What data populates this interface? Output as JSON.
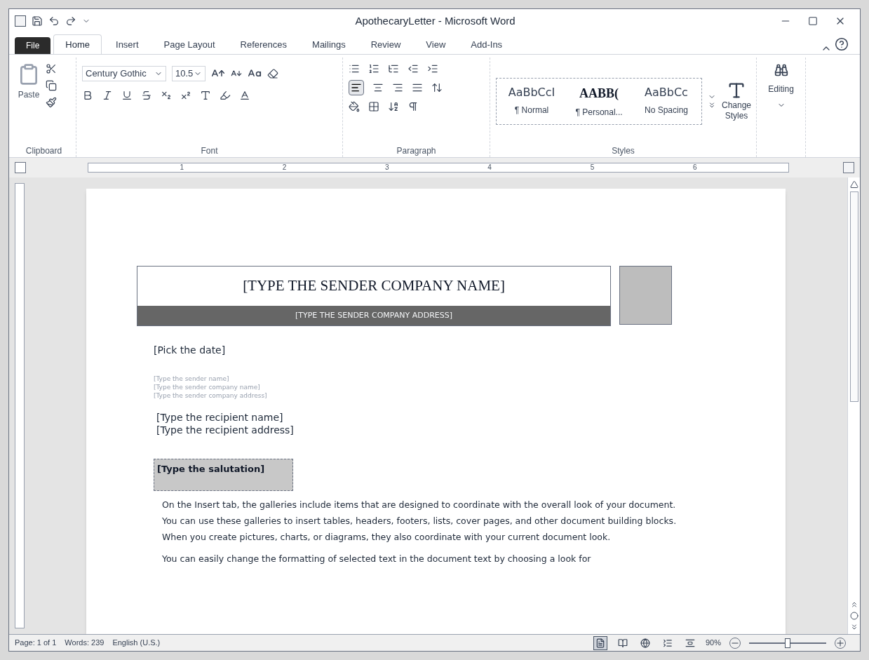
{
  "window": {
    "title": "ApothecaryLetter - Microsoft Word"
  },
  "tabs": [
    {
      "label": "File",
      "kind": "file",
      "selected": false
    },
    {
      "label": "Home",
      "kind": "tab",
      "selected": true
    },
    {
      "label": "Insert",
      "kind": "tab",
      "selected": false
    },
    {
      "label": "Page Layout",
      "kind": "tab",
      "selected": false
    },
    {
      "label": "References",
      "kind": "tab",
      "selected": false
    },
    {
      "label": "Mailings",
      "kind": "tab",
      "selected": false
    },
    {
      "label": "Review",
      "kind": "tab",
      "selected": false
    },
    {
      "label": "View",
      "kind": "tab",
      "selected": false
    },
    {
      "label": "Add-Ins",
      "kind": "tab",
      "selected": false
    }
  ],
  "ribbon": {
    "clipboard": {
      "label": "Clipboard",
      "paste": "Paste"
    },
    "font": {
      "label": "Font",
      "font_name": "Century Gothic",
      "font_size": "10.5"
    },
    "paragraph": {
      "label": "Paragraph"
    },
    "styles": {
      "label": "Styles",
      "items": [
        {
          "preview": "AaBbCcI",
          "name": "¶ Normal",
          "kind": "plain"
        },
        {
          "preview": "AABB(",
          "name": "¶ Personal...",
          "kind": "bold"
        },
        {
          "preview": "AaBbCc",
          "name": "No Spacing",
          "kind": "plain"
        }
      ],
      "change_styles": "Change Styles"
    },
    "editing": {
      "label": "Editing"
    }
  },
  "ruler": {
    "numbers": [
      "1",
      "2",
      "3",
      "4",
      "5",
      "6"
    ]
  },
  "document": {
    "company_name": "[TYPE THE SENDER COMPANY NAME]",
    "company_address": "[TYPE THE SENDER COMPANY ADDRESS]",
    "date": "[Pick the date]",
    "sender_lines": [
      "[Type the sender name]",
      "[Type the sender company name]",
      "[Type the sender company address]"
    ],
    "recipient_lines": [
      "[Type the recipient name]",
      "[Type the recipient address]"
    ],
    "salutation": "[Type the salutation]",
    "paragraphs": [
      "On the Insert tab, the galleries include items that are designed to coordinate with the overall look of your document. You can use these galleries to insert tables, headers, footers, lists, cover pages, and other document building blocks. When you create pictures, charts, or diagrams, they also coordinate with your current document look.",
      "You can easily change the formatting of selected text in the document text by choosing a look for"
    ]
  },
  "status_bar": {
    "page": "Page: 1 of 1",
    "words": "Words: 239",
    "language": "English (U.S.)",
    "views": [
      {
        "kind": "print",
        "selected": true
      },
      {
        "kind": "reading",
        "selected": false
      },
      {
        "kind": "web",
        "selected": false
      },
      {
        "kind": "outline",
        "selected": false
      },
      {
        "kind": "draft",
        "selected": false
      }
    ],
    "zoom": "90%",
    "zoom_slider": {
      "level": 0.5
    }
  }
}
